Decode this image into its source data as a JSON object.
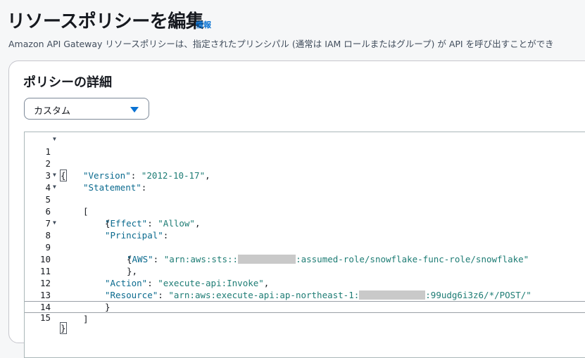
{
  "page": {
    "title": "リソースポリシーを編集",
    "info_link": "情報",
    "description": "Amazon API Gateway リソースポリシーは、指定されたプリンシパル (通常は IAM ロールまたはグループ) が API を呼び出すことができ"
  },
  "policy_section": {
    "title": "ポリシーの詳細",
    "template_select": {
      "value": "カスタム",
      "icon": "caret-down-icon"
    }
  },
  "editor": {
    "line_numbers": [
      "1",
      "2",
      "3",
      "4",
      "5",
      "6",
      "7",
      "8",
      "9",
      "10",
      "11",
      "12",
      "13",
      "14",
      "15"
    ],
    "tokens": {
      "open_brace": "{",
      "close_brace": "}",
      "open_bracket": "[",
      "close_bracket": "]",
      "version_key": "\"Version\"",
      "version_value": "\"2012-10-17\"",
      "statement_key": "\"Statement\"",
      "effect_key": "\"Effect\"",
      "effect_value": "\"Allow\"",
      "principal_key": "\"Principal\"",
      "aws_key": "\"AWS\"",
      "aws_value_prefix": "\"arn:aws:sts::",
      "aws_value_suffix": ":assumed-role/snowflake-func-role/snowflake\"",
      "action_key": "\"Action\"",
      "action_value": "\"execute-api:Invoke\"",
      "resource_key": "\"Resource\"",
      "resource_value_prefix": "\"arn:aws:execute-api:ap-northeast-1:",
      "resource_value_suffix": ":99udg6i3z6/*/POST/\"",
      "colon": ": ",
      "comma": ",",
      "close_brace_comma": "},"
    }
  }
}
